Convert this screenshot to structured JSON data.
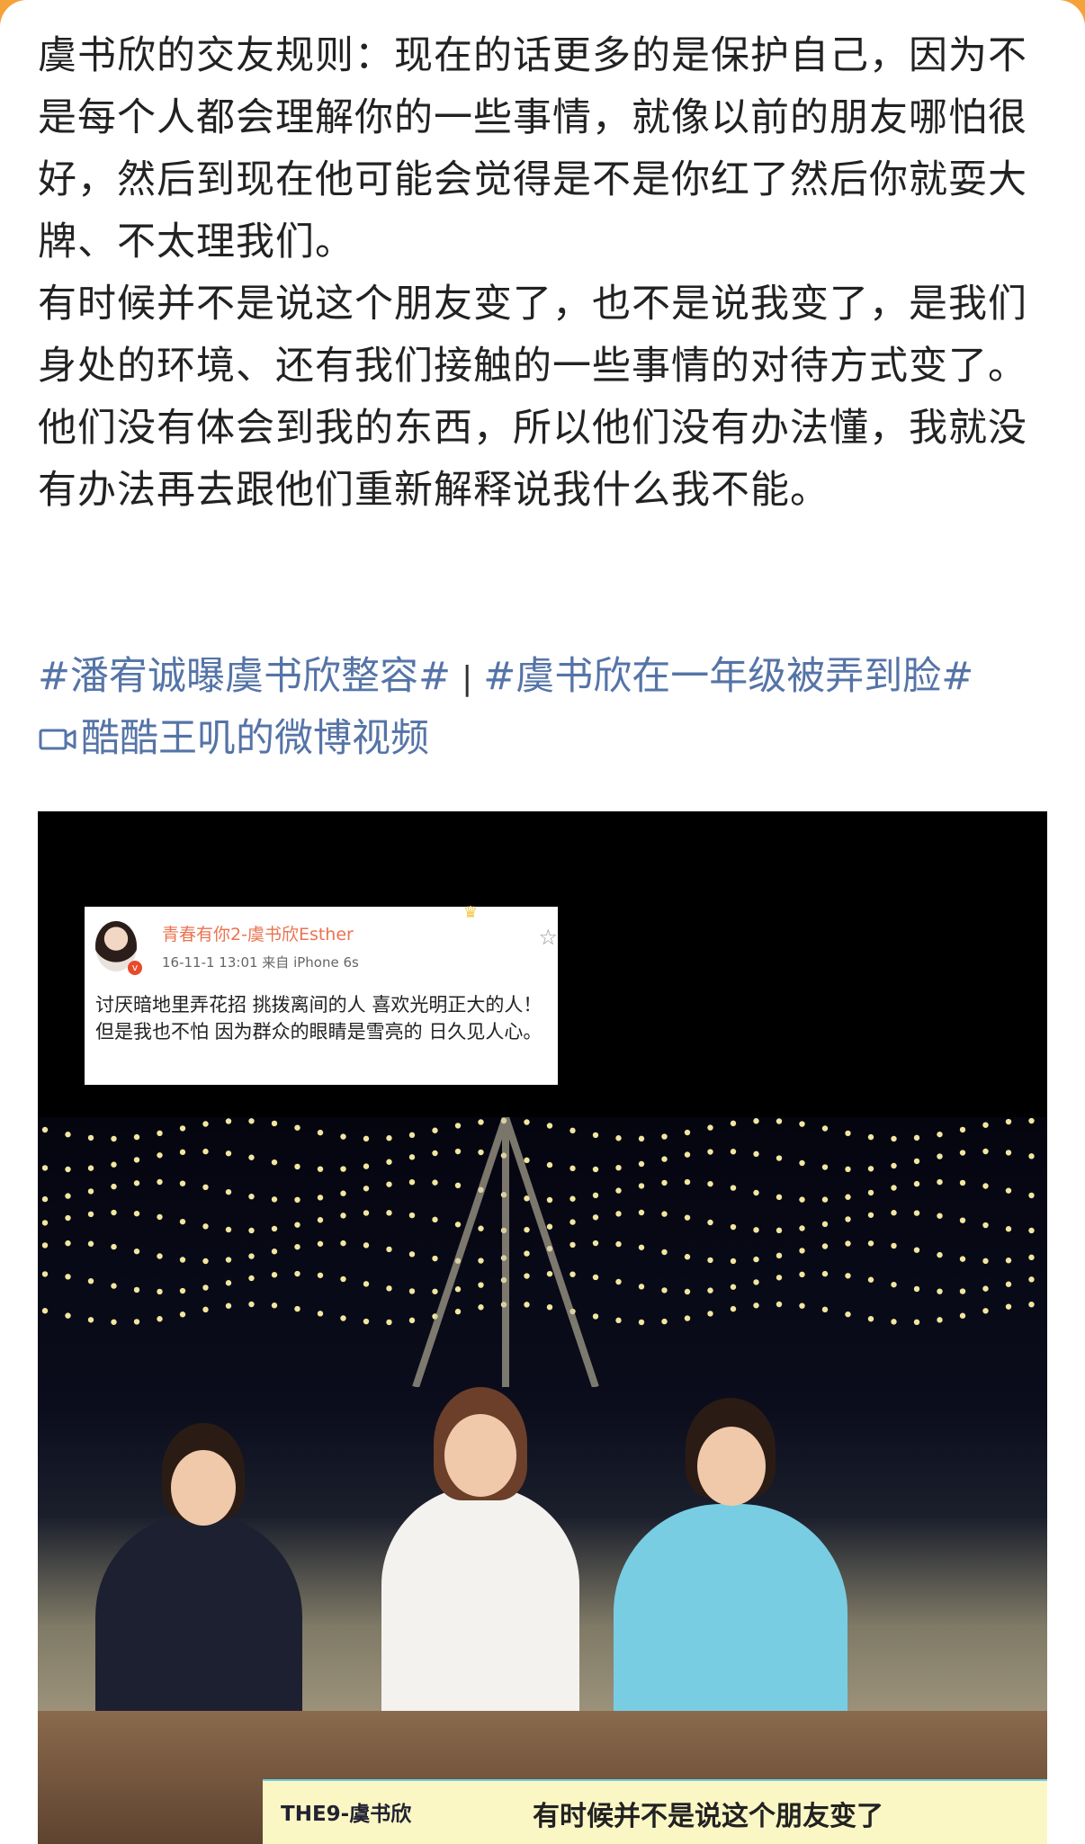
{
  "post": {
    "body": "虞书欣的交友规则：现在的话更多的是保护自己，因为不是每个人都会理解你的一些事情，就像以前的朋友哪怕很好，然后到现在他可能会觉得是不是你红了然后你就耍大牌、不太理我们。\n有时候并不是说这个朋友变了，也不是说我变了，是我们身处的环境、还有我们接触的一些事情的对待方式变了。他们没有体会到我的东西，所以他们没有办法懂，我就没有办法再去跟他们重新解释说我什么我不能。",
    "tags": [
      "#潘宥诚曝虞书欣整容#",
      "#虞书欣在一年级被弄到脸#"
    ],
    "separator": "|",
    "video_link": "酷酷王叽的微博视频"
  },
  "embedded_weibo": {
    "name": "青春有你2-虞书欣Esther",
    "meta": "16-11-1 13:01  来自 iPhone 6s",
    "body": "讨厌暗地里弄花招 挑拨离间的人 喜欢光明正大的人！但是我也不怕 因为群众的眼睛是雪亮的 日久见人心。"
  },
  "subtitle": {
    "badge": "THE9-虞书欣",
    "text": "有时候并不是说这个朋友变了"
  }
}
